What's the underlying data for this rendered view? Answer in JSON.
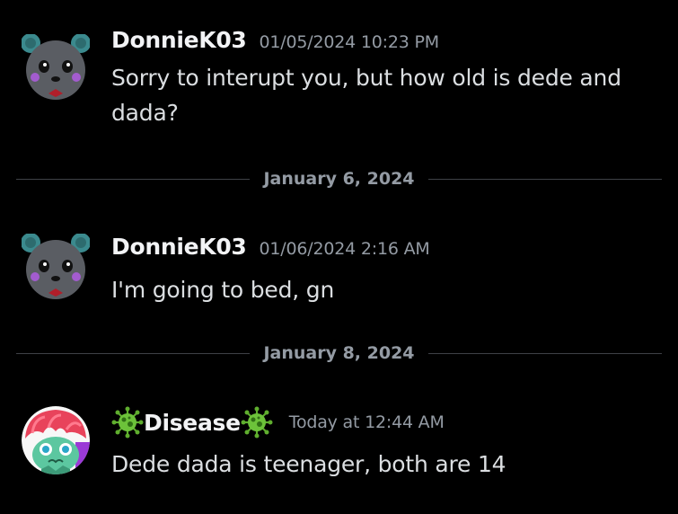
{
  "messages": [
    {
      "username": "DonnieK03",
      "timestamp": "01/05/2024 10:23 PM",
      "content": "Sorry to interupt you, but how old is dede and dada?",
      "avatar_icon": "panda-avatar"
    },
    {
      "username": "DonnieK03",
      "timestamp": "01/06/2024 2:16 AM",
      "content": "I'm going to bed, gn",
      "avatar_icon": "panda-avatar"
    },
    {
      "username": "Disease",
      "timestamp": "Today at 12:44 AM",
      "content": "Dede dada is teenager, both are 14",
      "avatar_icon": "mushroom-avatar",
      "name_decoration_icon": "virus-icon"
    }
  ],
  "dividers": [
    {
      "date": "January 6, 2024"
    },
    {
      "date": "January 8, 2024"
    }
  ],
  "colors": {
    "background": "#000000",
    "username": "#f2f3f5",
    "text": "#dbdee1",
    "muted": "#949ba4",
    "divider_line": "#3f4147",
    "virus_green": "#5fae2e"
  }
}
